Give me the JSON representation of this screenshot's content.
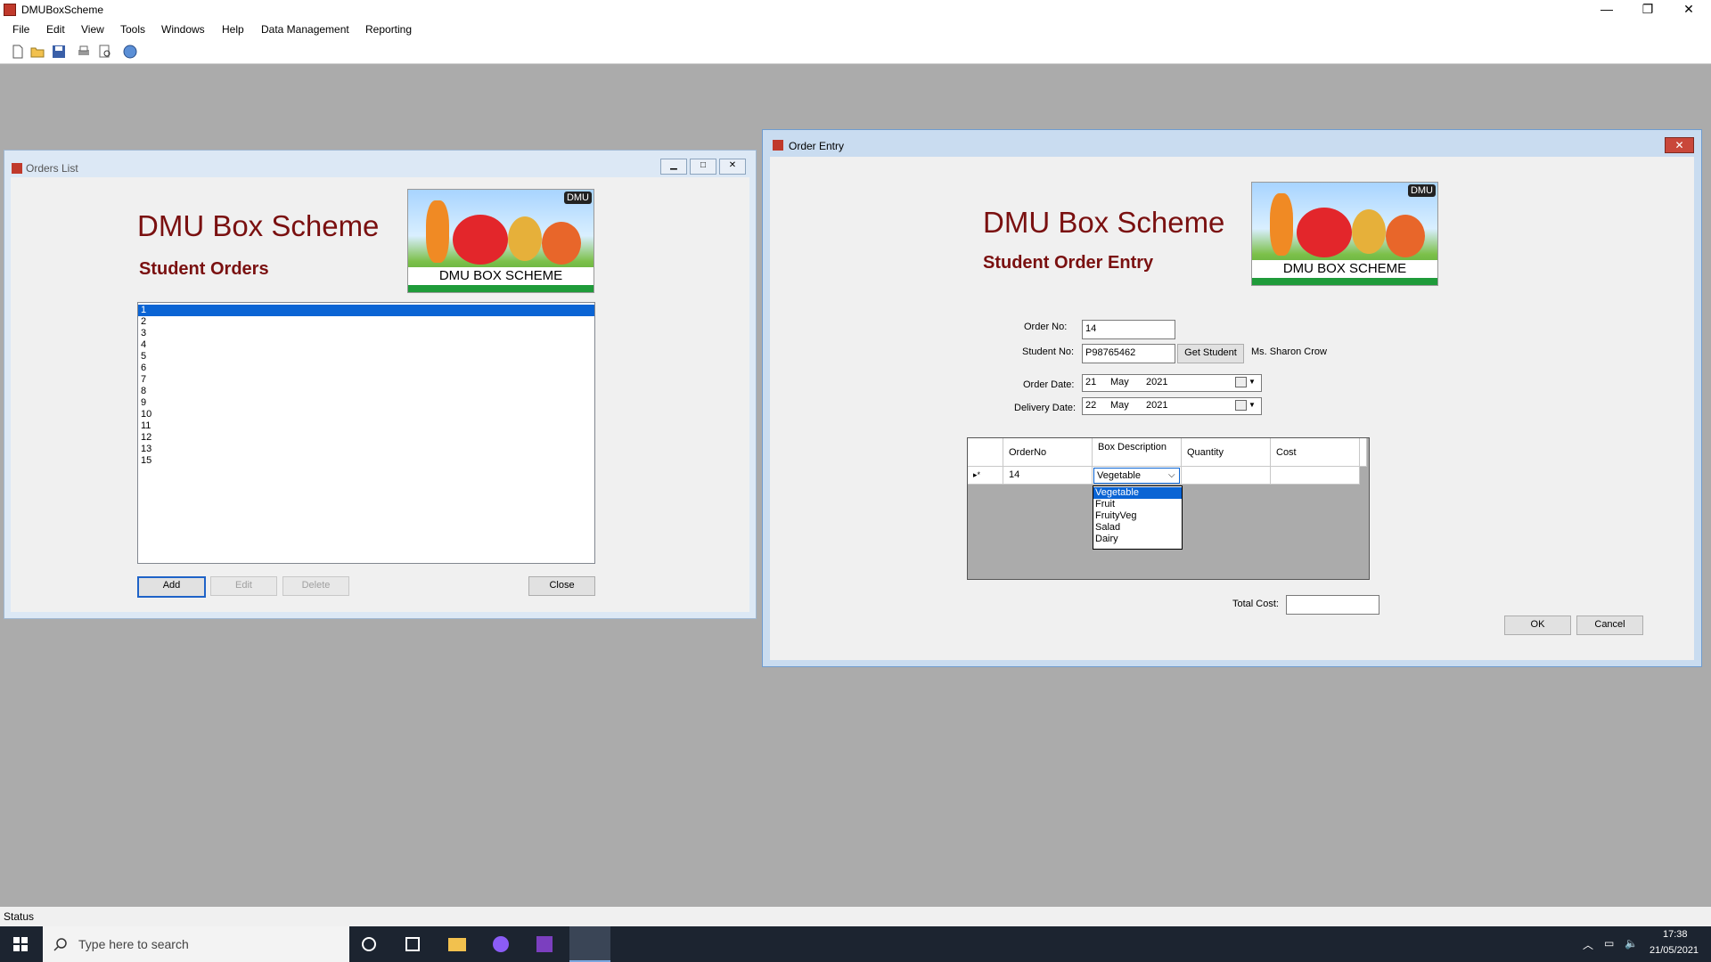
{
  "app": {
    "title": "DMUBoxScheme"
  },
  "menu": [
    "File",
    "Edit",
    "View",
    "Tools",
    "Windows",
    "Help",
    "Data Management",
    "Reporting"
  ],
  "toolbar_icons": [
    "new-file-icon",
    "open-folder-icon",
    "save-icon",
    "print-icon",
    "print-preview-icon",
    "help-icon"
  ],
  "orders_list": {
    "title": "Orders List",
    "heading": "DMU Box Scheme",
    "subheading": "Student Orders",
    "logo_caption": "DMU BOX SCHEME",
    "logo_badge": "DMU",
    "items": [
      "1",
      "2",
      "3",
      "4",
      "5",
      "6",
      "7",
      "8",
      "9",
      "10",
      "11",
      "12",
      "13",
      "15"
    ],
    "selected": "1",
    "buttons": {
      "add": "Add",
      "edit": "Edit",
      "delete": "Delete",
      "close": "Close"
    }
  },
  "order_entry": {
    "title": "Order Entry",
    "heading": "DMU Box Scheme",
    "subheading": "Student Order Entry",
    "logo_caption": "DMU BOX SCHEME",
    "logo_badge": "DMU",
    "order_no_label": "Order No:",
    "order_no": "14",
    "student_no_label": "Student No:",
    "student_no": "P98765462",
    "get_student": "Get Student",
    "student_name": "Ms. Sharon Crow",
    "order_date_label": "Order Date:",
    "order_date": {
      "day": "21",
      "month": "May",
      "year": "2021"
    },
    "delivery_date_label": "Delivery Date:",
    "delivery_date": {
      "day": "22",
      "month": "May",
      "year": "2021"
    },
    "grid": {
      "headers": [
        "OrderNo",
        "Box Description",
        "Quantity",
        "Cost"
      ],
      "row": {
        "indicator": "▸*",
        "order_no": "14",
        "box": "Vegetable",
        "quantity": "",
        "cost": ""
      },
      "dropdown_options": [
        "Vegetable",
        "Fruit",
        "FruityVeg",
        "Salad",
        "Dairy"
      ],
      "dropdown_selected": "Vegetable"
    },
    "total_cost_label": "Total Cost:",
    "total_cost": "",
    "ok": "OK",
    "cancel": "Cancel"
  },
  "status": {
    "text": "Status"
  },
  "taskbar": {
    "search_placeholder": "Type here to search",
    "time": "17:38",
    "date": "21/05/2021"
  }
}
